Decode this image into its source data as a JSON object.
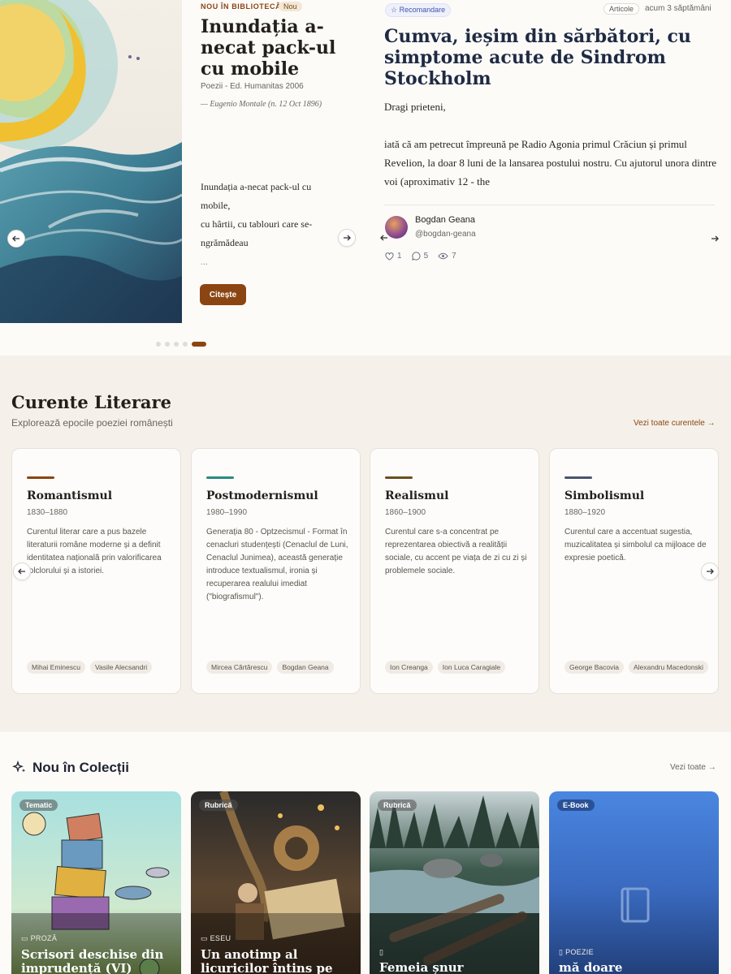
{
  "hero": {
    "book": {
      "eyebrow": "NOU ÎN BIBLIOTECĂ",
      "badge": "Nou",
      "title": "Inundația a-necat pack-ul cu mobile",
      "meta": "Poezii - Ed. Humanitas 2006",
      "author": "— Eugenio Montale (n. 12 Oct 1896)",
      "excerpt_lines": [
        "Inundația a-necat pack-ul cu mobile,",
        "cu hârtii, cu tablouri care se-ngrămădeau",
        "..."
      ],
      "read_label": "Citește"
    },
    "slides": {
      "count": 5,
      "active_index": 4
    },
    "article": {
      "recommend_label": "Recomandare",
      "category": "Articole",
      "time": "acum 3 săptămâni",
      "title": "Cumva, ieșim din sărbători, cu simptome acute de Sindrom Stockholm",
      "greeting": "Dragi prieteni,",
      "body": "iată că am petrecut împreună pe Radio Agonia primul Crăciun și primul Revelion, la doar 8 luni de la lansarea postului nostru. Cu ajutorul unora dintre voi (aproximativ 12 - the",
      "author_name": "Bogdan Geana",
      "author_handle": "@bogdan-geana",
      "likes": "1",
      "comments": "5",
      "views": "7"
    }
  },
  "curente": {
    "title": "Curente Literare",
    "subtitle": "Explorează epocile poeziei românești",
    "link": "Vezi toate curentele →",
    "cards": [
      {
        "title": "Romantismul",
        "years": "1830–1880",
        "color": "#8b4513",
        "desc": "Curentul literar care a pus bazele literaturii române moderne și a definit identitatea națională prin valorificarea folclorului și a istoriei.",
        "authors": [
          "Mihai Eminescu",
          "Vasile Alecsandri"
        ]
      },
      {
        "title": "Postmodernismul",
        "years": "1980–1990",
        "color": "#2a8a80",
        "desc": "Generația 80 - Optzecismul - Format în cenacluri studențești (Cenaclul de Luni, Cenaclul Junimea), această generație introduce textualismul, ironia și recuperarea realului imediat (\"biografismul\").",
        "authors": [
          "Mircea Cărtărescu",
          "Bogdan Geana"
        ]
      },
      {
        "title": "Realismul",
        "years": "1860–1900",
        "color": "#6b4f1e",
        "desc": "Curentul care s-a concentrat pe reprezentarea obiectivă a realității sociale, cu accent pe viața de zi cu zi și problemele sociale.",
        "authors": [
          "Ion Creanga",
          "Ion Luca Caragiale"
        ]
      },
      {
        "title": "Simbolismul",
        "years": "1880–1920",
        "color": "#4a5470",
        "desc": "Curentul care a accentuat sugestia, muzicalitatea și simbolul ca mijloace de expresie poetică.",
        "authors": [
          "George Bacovia",
          "Alexandru Macedonski"
        ]
      }
    ]
  },
  "colectii": {
    "title": "Nou în Colecții",
    "link": "Vezi toate",
    "cards": [
      {
        "badge": "Tematic",
        "type": "PROZĂ",
        "title": "Scrisori deschise din imprudență (VI)",
        "icon": "document-icon"
      },
      {
        "badge": "Rubrică",
        "type": "ESEU",
        "title": "Un anotimp al licuricilor întins pe palma sorții",
        "icon": "document-icon"
      },
      {
        "badge": "Rubrică",
        "type": "",
        "title": "Femeia șnur",
        "icon": "book-icon"
      },
      {
        "badge": "E-Book",
        "type": "POEZIE",
        "title": "mă doare",
        "icon": "book-icon"
      }
    ]
  }
}
